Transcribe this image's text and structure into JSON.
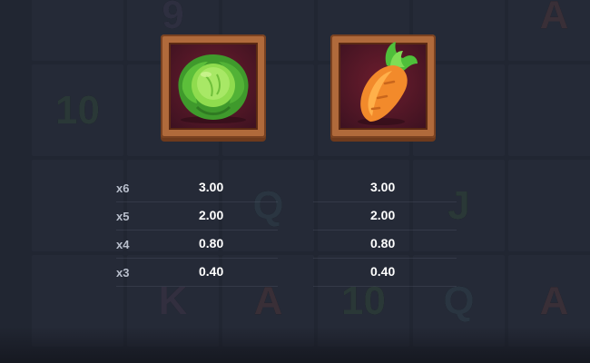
{
  "background_symbols": [
    "9",
    "A",
    "10",
    "Q",
    "J",
    "K",
    "A",
    "10",
    "Q",
    "A"
  ],
  "symbols": [
    {
      "name": "cabbage",
      "icon": "cabbage-icon"
    },
    {
      "name": "carrot",
      "icon": "carrot-icon"
    }
  ],
  "paytables": [
    {
      "rows": [
        {
          "mult": "x6",
          "value": "3.00"
        },
        {
          "mult": "x5",
          "value": "2.00"
        },
        {
          "mult": "x4",
          "value": "0.80"
        },
        {
          "mult": "x3",
          "value": "0.40"
        }
      ]
    },
    {
      "rows": [
        {
          "mult": "",
          "value": "3.00"
        },
        {
          "mult": "",
          "value": "2.00"
        },
        {
          "mult": "",
          "value": "0.80"
        },
        {
          "mult": "",
          "value": "0.40"
        }
      ]
    }
  ],
  "colors": {
    "background": "#262b38",
    "frame_wood": "#b06a3b",
    "frame_inner": "#4a1524",
    "value_text": "#ffffff",
    "mult_text": "#b9bfcc"
  }
}
